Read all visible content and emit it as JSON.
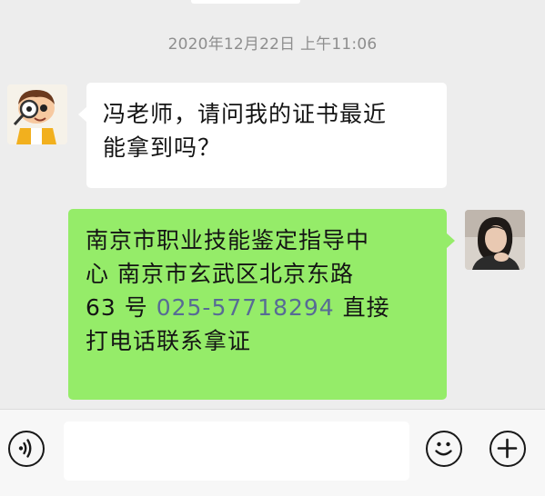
{
  "chat": {
    "timestamp": "2020年12月22日 上午11:06",
    "messages": [
      {
        "side": "left",
        "avatar_icon": "cartoon-boy-magnifier-avatar",
        "lines": [
          "冯老师，请问我的证书最近",
          "能拿到吗？"
        ]
      },
      {
        "side": "right",
        "avatar_icon": "woman-photo-avatar",
        "bubble_color": "#95ec69",
        "line1": "南京市职业技能鉴定指导中",
        "line2": "心 南京市玄武区北京东路",
        "line3_prefix": "63 号 ",
        "phone": "025-57718294",
        "line3_suffix": " 直接",
        "line4": "打电话联系拿证",
        "phone_link_color": "#576b95"
      }
    ]
  },
  "input_bar": {
    "voice_icon": "voice-icon",
    "text_value": "",
    "emoji_icon": "emoji-icon",
    "more_icon": "plus-icon"
  },
  "colors": {
    "background": "#ededed",
    "incoming_bubble": "#ffffff",
    "outgoing_bubble": "#95ec69",
    "timestamp": "#8e8e8e"
  }
}
